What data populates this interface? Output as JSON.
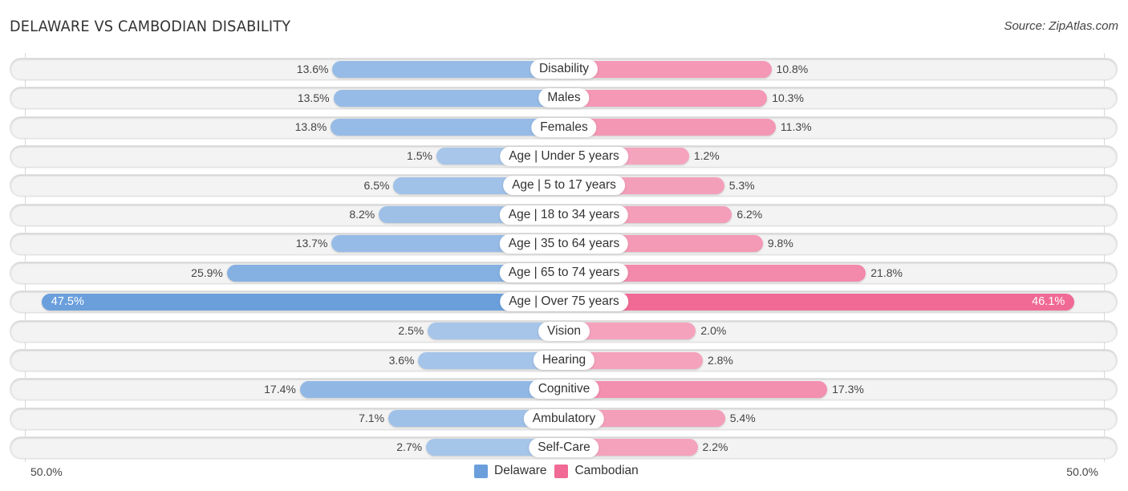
{
  "header": {
    "title": "DELAWARE VS CAMBODIAN DISABILITY",
    "source": "Source: ZipAtlas.com"
  },
  "colors": {
    "delaware_strong": "#6a9fdc",
    "delaware_light": "#a9c7ea",
    "cambodian_strong": "#f06a95",
    "cambodian_light": "#f5a6bf"
  },
  "axis": {
    "left_label": "50.0%",
    "right_label": "50.0%"
  },
  "legend": {
    "items": [
      {
        "label": "Delaware",
        "color": "#6a9fdc"
      },
      {
        "label": "Cambodian",
        "color": "#f06a95"
      }
    ]
  },
  "chart_data": {
    "type": "bar",
    "orientation": "horizontal-diverging",
    "title": "DELAWARE VS CAMBODIAN DISABILITY",
    "xlabel": "",
    "ylabel": "",
    "xlim": [
      -50.0,
      50.0
    ],
    "legend_position": "bottom-center",
    "categories": [
      "Disability",
      "Males",
      "Females",
      "Age | Under 5 years",
      "Age | 5 to 17 years",
      "Age | 18 to 34 years",
      "Age | 35 to 64 years",
      "Age | 65 to 74 years",
      "Age | Over 75 years",
      "Vision",
      "Hearing",
      "Cognitive",
      "Ambulatory",
      "Self-Care"
    ],
    "series": [
      {
        "name": "Delaware",
        "side": "left",
        "values": [
          13.6,
          13.5,
          13.8,
          1.5,
          6.5,
          8.2,
          13.7,
          25.9,
          47.5,
          2.5,
          3.6,
          17.4,
          7.1,
          2.7
        ],
        "labels": [
          "13.6%",
          "13.5%",
          "13.8%",
          "1.5%",
          "6.5%",
          "8.2%",
          "13.7%",
          "25.9%",
          "47.5%",
          "2.5%",
          "3.6%",
          "17.4%",
          "7.1%",
          "2.7%"
        ]
      },
      {
        "name": "Cambodian",
        "side": "right",
        "values": [
          10.8,
          10.3,
          11.3,
          1.2,
          5.3,
          6.2,
          9.8,
          21.8,
          46.1,
          2.0,
          2.8,
          17.3,
          5.4,
          2.2
        ],
        "labels": [
          "10.8%",
          "10.3%",
          "11.3%",
          "1.2%",
          "5.3%",
          "6.2%",
          "9.8%",
          "21.8%",
          "46.1%",
          "2.0%",
          "2.8%",
          "17.3%",
          "5.4%",
          "2.2%"
        ]
      }
    ]
  }
}
